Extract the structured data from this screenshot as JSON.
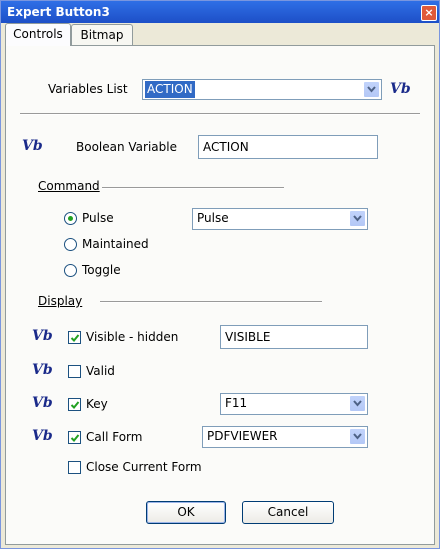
{
  "window": {
    "title": "Expert Button3",
    "close_label": "×"
  },
  "tabs": [
    {
      "label": "Controls"
    },
    {
      "label": "Bitmap"
    }
  ],
  "vb_label": "Vb",
  "variables_list": {
    "label": "Variables List",
    "value": "ACTION"
  },
  "boolean_variable": {
    "label": "Boolean Variable",
    "value": "ACTION"
  },
  "command": {
    "heading": "Command",
    "options": [
      {
        "label": "Pulse"
      },
      {
        "label": "Maintained"
      },
      {
        "label": "Toggle"
      }
    ],
    "selected": "Pulse",
    "combo_value": "Pulse"
  },
  "display": {
    "heading": "Display",
    "visible_hidden": {
      "label": "Visible - hidden",
      "value": "VISIBLE",
      "checked": true
    },
    "valid": {
      "label": "Valid",
      "checked": false
    },
    "key": {
      "label": "Key",
      "value": "F11",
      "checked": true
    },
    "call_form": {
      "label": "Call Form",
      "value": "PDFVIEWER",
      "checked": true
    },
    "close_current_form": {
      "label": "Close Current Form",
      "checked": false
    }
  },
  "buttons": {
    "ok": "OK",
    "cancel": "Cancel"
  },
  "colors": {
    "titlebar": "#1d4fc7",
    "vb": "#1a2a8a",
    "selection": "#316ac5"
  }
}
